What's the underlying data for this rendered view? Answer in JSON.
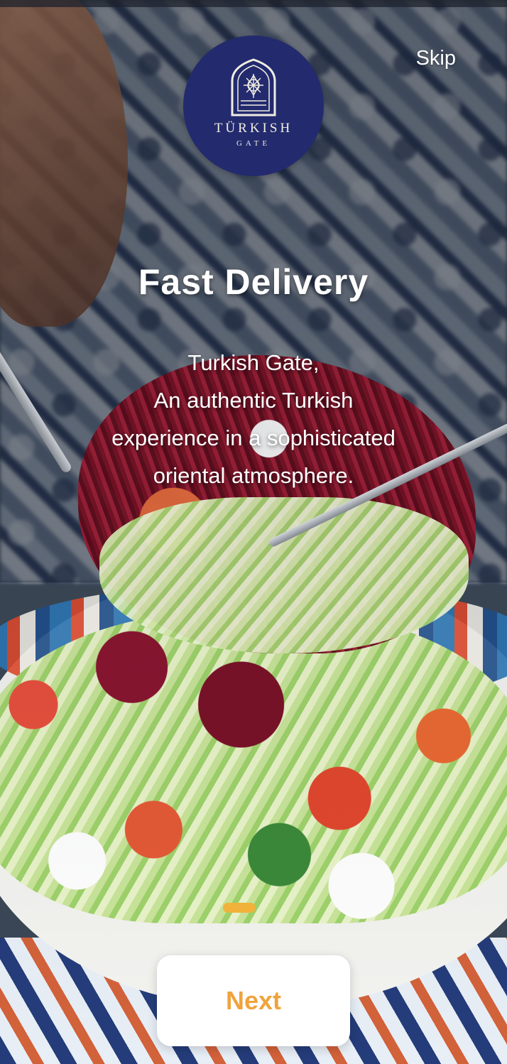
{
  "logo": {
    "word1": "TÜRKISH",
    "word2": "GATE",
    "icon": "mosque-arch-logo-icon",
    "bg_color": "#232b6e"
  },
  "header": {
    "skip_label": "Skip"
  },
  "onboarding": {
    "title": "Fast Delivery",
    "description_lines": [
      "Turkish Gate,",
      "An authentic Turkish",
      "experience in a sophisticated",
      "oriental atmosphere."
    ],
    "page_indicator": {
      "current": 1
    }
  },
  "footer": {
    "next_label": "Next"
  },
  "colors": {
    "accent": "#f0a33c",
    "indicator": "#f0b23a",
    "text": "#ffffff"
  }
}
